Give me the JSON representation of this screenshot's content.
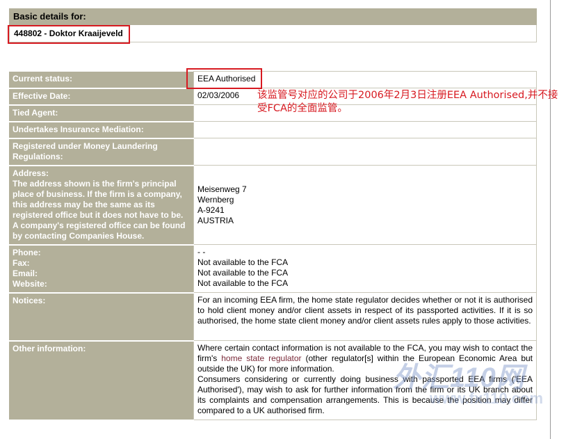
{
  "basic": {
    "heading": "Basic details for:",
    "firm_id": "448802 - Doktor Kraaijeveld"
  },
  "details": {
    "current_status": {
      "label": "Current status:",
      "value": "EEA Authorised"
    },
    "effective_date": {
      "label": "Effective Date:",
      "value": "02/03/2006"
    },
    "tied_agent": {
      "label": "Tied Agent:",
      "value": ""
    },
    "insurance_mediation": {
      "label": "Undertakes Insurance Mediation:",
      "value": ""
    },
    "money_laundering": {
      "label": "Registered under Money Laundering Regulations:",
      "value": ""
    },
    "address": {
      "label": "Address:",
      "label_note": "The address shown is the firm's principal place of business. If the firm is a company, this address may be the same as its registered office but it does not have to be. A company's registered office can be found by contacting Companies House.",
      "lines": [
        "Meisenweg 7",
        "Wernberg",
        "A-9241",
        "AUSTRIA"
      ]
    },
    "contact": {
      "phone_label": "Phone:",
      "fax_label": "Fax:",
      "email_label": "Email:",
      "website_label": "Website:",
      "phone": "- -",
      "fax": "Not available to the FCA",
      "email": "Not available to the FCA",
      "website": "Not available to the FCA"
    },
    "notices": {
      "label": "Notices:",
      "text": "For an incoming EEA firm, the home state regulator decides whether or not it is authorised to hold client money and/or client assets in respect of its passported activities. If it is so authorised, the home state client money and/or client assets rules apply to those activities."
    },
    "other_info": {
      "label": "Other information:",
      "p1_before": "Where certain contact information is not available to the FCA, you may wish to contact the firm's ",
      "p1_link": "home state regulator",
      "p1_after": " (other regulator[s] within the European Economic Area but outside the UK) for more information.",
      "p2": "Consumers considering or currently doing business with passported EEA firms ('EEA Authorised'), may wish to ask for further information from the firm or its UK branch about its complaints and compensation arrangements. This is because the position may differ compared to a UK authorised firm."
    }
  },
  "annotation": {
    "text": "该监管号对应的公司于2006年2月3日注册EEA Authorised,并不接受FCA的全面监管。"
  },
  "watermark": {
    "main": "外汇110网",
    "sub": "www.fx110.com"
  },
  "colors": {
    "label_bg": "#b3b09a",
    "annotation_red": "#d71920",
    "link": "#7a2b3a"
  }
}
